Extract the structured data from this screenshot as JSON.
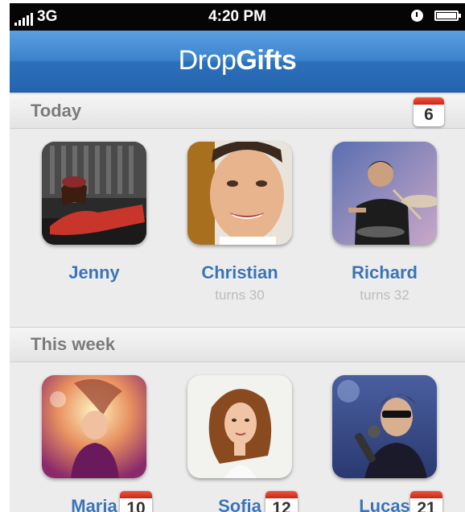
{
  "status_bar": {
    "carrier": "3G",
    "time": "4:20 PM"
  },
  "app": {
    "title_part1": "Drop",
    "title_part2": "Gifts"
  },
  "colors": {
    "nav_blue": "#3c83cc",
    "name_blue": "#3a73b8",
    "calendar_red": "#d8331f"
  },
  "sections": [
    {
      "title": "Today",
      "badge": "6",
      "people": [
        {
          "name": "Jenny",
          "subtitle": ""
        },
        {
          "name": "Christian",
          "subtitle": "turns 30"
        },
        {
          "name": "Richard",
          "subtitle": "turns 32"
        }
      ]
    },
    {
      "title": "This week",
      "people": [
        {
          "name": "Maria",
          "badge": "10"
        },
        {
          "name": "Sofia",
          "badge": "12"
        },
        {
          "name": "Lucas",
          "badge": "21"
        }
      ]
    }
  ]
}
